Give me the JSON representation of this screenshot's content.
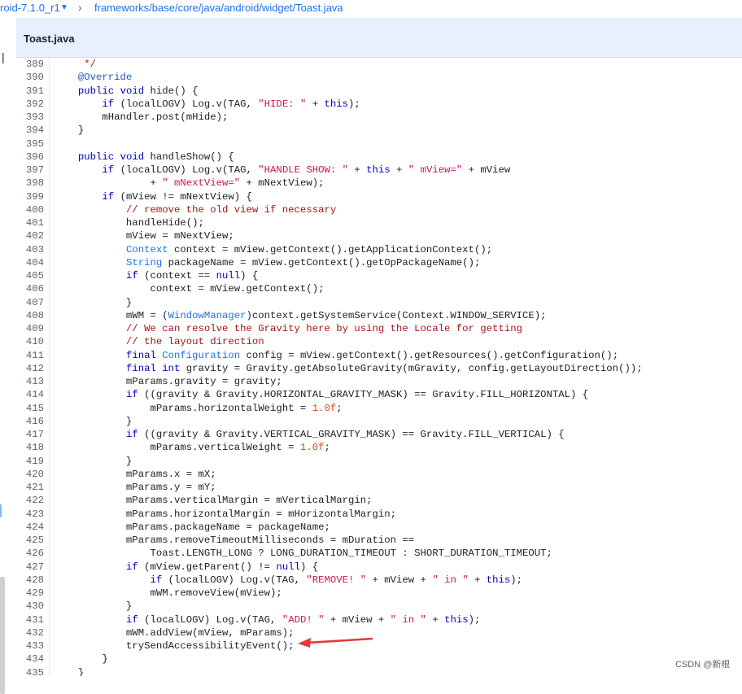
{
  "breadcrumb": {
    "branch": "roid-7.1.0_r1",
    "separator": "›",
    "path": "frameworks/base/core/java/android/widget/Toast.java"
  },
  "tab": {
    "label": "Toast.java"
  },
  "code_lines": [
    {
      "n": "389",
      "t": "      */"
    },
    {
      "n": "390",
      "t": "     @Override"
    },
    {
      "n": "391",
      "t": "     public void hide() {"
    },
    {
      "n": "392",
      "t": "         if (localLOGV) Log.v(TAG, \"HIDE: \" + this);"
    },
    {
      "n": "393",
      "t": "         mHandler.post(mHide);"
    },
    {
      "n": "394",
      "t": "     }"
    },
    {
      "n": "395",
      "t": ""
    },
    {
      "n": "396",
      "t": "     public void handleShow() {"
    },
    {
      "n": "397",
      "t": "         if (localLOGV) Log.v(TAG, \"HANDLE SHOW: \" + this + \" mView=\" + mView"
    },
    {
      "n": "398",
      "t": "                 + \" mNextView=\" + mNextView);"
    },
    {
      "n": "399",
      "t": "         if (mView != mNextView) {"
    },
    {
      "n": "400",
      "t": "             // remove the old view if necessary"
    },
    {
      "n": "401",
      "t": "             handleHide();"
    },
    {
      "n": "402",
      "t": "             mView = mNextView;"
    },
    {
      "n": "403",
      "t": "             Context context = mView.getContext().getApplicationContext();"
    },
    {
      "n": "404",
      "t": "             String packageName = mView.getContext().getOpPackageName();"
    },
    {
      "n": "405",
      "t": "             if (context == null) {"
    },
    {
      "n": "406",
      "t": "                 context = mView.getContext();"
    },
    {
      "n": "407",
      "t": "             }"
    },
    {
      "n": "408",
      "t": "             mWM = (WindowManager)context.getSystemService(Context.WINDOW_SERVICE);"
    },
    {
      "n": "409",
      "t": "             // We can resolve the Gravity here by using the Locale for getting"
    },
    {
      "n": "410",
      "t": "             // the layout direction"
    },
    {
      "n": "411",
      "t": "             final Configuration config = mView.getContext().getResources().getConfiguration();"
    },
    {
      "n": "412",
      "t": "             final int gravity = Gravity.getAbsoluteGravity(mGravity, config.getLayoutDirection());"
    },
    {
      "n": "413",
      "t": "             mParams.gravity = gravity;"
    },
    {
      "n": "414",
      "t": "             if ((gravity & Gravity.HORIZONTAL_GRAVITY_MASK) == Gravity.FILL_HORIZONTAL) {"
    },
    {
      "n": "415",
      "t": "                 mParams.horizontalWeight = 1.0f;"
    },
    {
      "n": "416",
      "t": "             }"
    },
    {
      "n": "417",
      "t": "             if ((gravity & Gravity.VERTICAL_GRAVITY_MASK) == Gravity.FILL_VERTICAL) {"
    },
    {
      "n": "418",
      "t": "                 mParams.verticalWeight = 1.0f;"
    },
    {
      "n": "419",
      "t": "             }"
    },
    {
      "n": "420",
      "t": "             mParams.x = mX;"
    },
    {
      "n": "421",
      "t": "             mParams.y = mY;"
    },
    {
      "n": "422",
      "t": "             mParams.verticalMargin = mVerticalMargin;"
    },
    {
      "n": "423",
      "t": "             mParams.horizontalMargin = mHorizontalMargin;"
    },
    {
      "n": "424",
      "t": "             mParams.packageName = packageName;"
    },
    {
      "n": "425",
      "t": "             mParams.removeTimeoutMilliseconds = mDuration =="
    },
    {
      "n": "426",
      "t": "                 Toast.LENGTH_LONG ? LONG_DURATION_TIMEOUT : SHORT_DURATION_TIMEOUT;"
    },
    {
      "n": "427",
      "t": "             if (mView.getParent() != null) {"
    },
    {
      "n": "428",
      "t": "                 if (localLOGV) Log.v(TAG, \"REMOVE! \" + mView + \" in \" + this);"
    },
    {
      "n": "429",
      "t": "                 mWM.removeView(mView);"
    },
    {
      "n": "430",
      "t": "             }"
    },
    {
      "n": "431",
      "t": "             if (localLOGV) Log.v(TAG, \"ADD! \" + mView + \" in \" + this);"
    },
    {
      "n": "432",
      "t": "             mWM.addView(mView, mParams);"
    },
    {
      "n": "433",
      "t": "             trySendAccessibilityEvent();"
    },
    {
      "n": "434",
      "t": "         }"
    },
    {
      "n": "435",
      "t": "     }"
    }
  ],
  "watermark": "CSDN @新根",
  "colors": {
    "link": "#1a73e8",
    "tab_bg": "#e8f0fe",
    "keyword": "#0000c0",
    "string": "#c2185b",
    "comment": "#a31515",
    "number": "#d04b0e",
    "arrow": "#e53935"
  }
}
